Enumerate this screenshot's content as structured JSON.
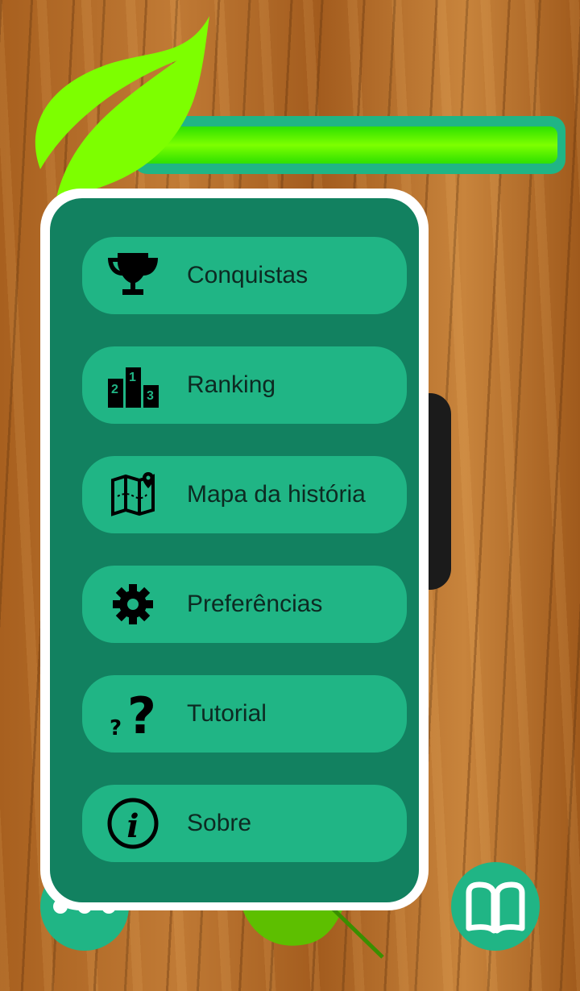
{
  "progress": {
    "fraction": 1.0,
    "color": "#7dff00"
  },
  "menu": {
    "items": [
      {
        "label": "Conquistas",
        "icon": "trophy-icon"
      },
      {
        "label": "Ranking",
        "icon": "podium-icon"
      },
      {
        "label": "Mapa da história",
        "icon": "map-icon"
      },
      {
        "label": "Preferências",
        "icon": "gear-icon"
      },
      {
        "label": "Tutorial",
        "icon": "question-icon"
      },
      {
        "label": "Sobre",
        "icon": "info-icon"
      }
    ]
  },
  "colors": {
    "panel": "#128160",
    "item": "#20b585",
    "accent": "#20b585"
  }
}
